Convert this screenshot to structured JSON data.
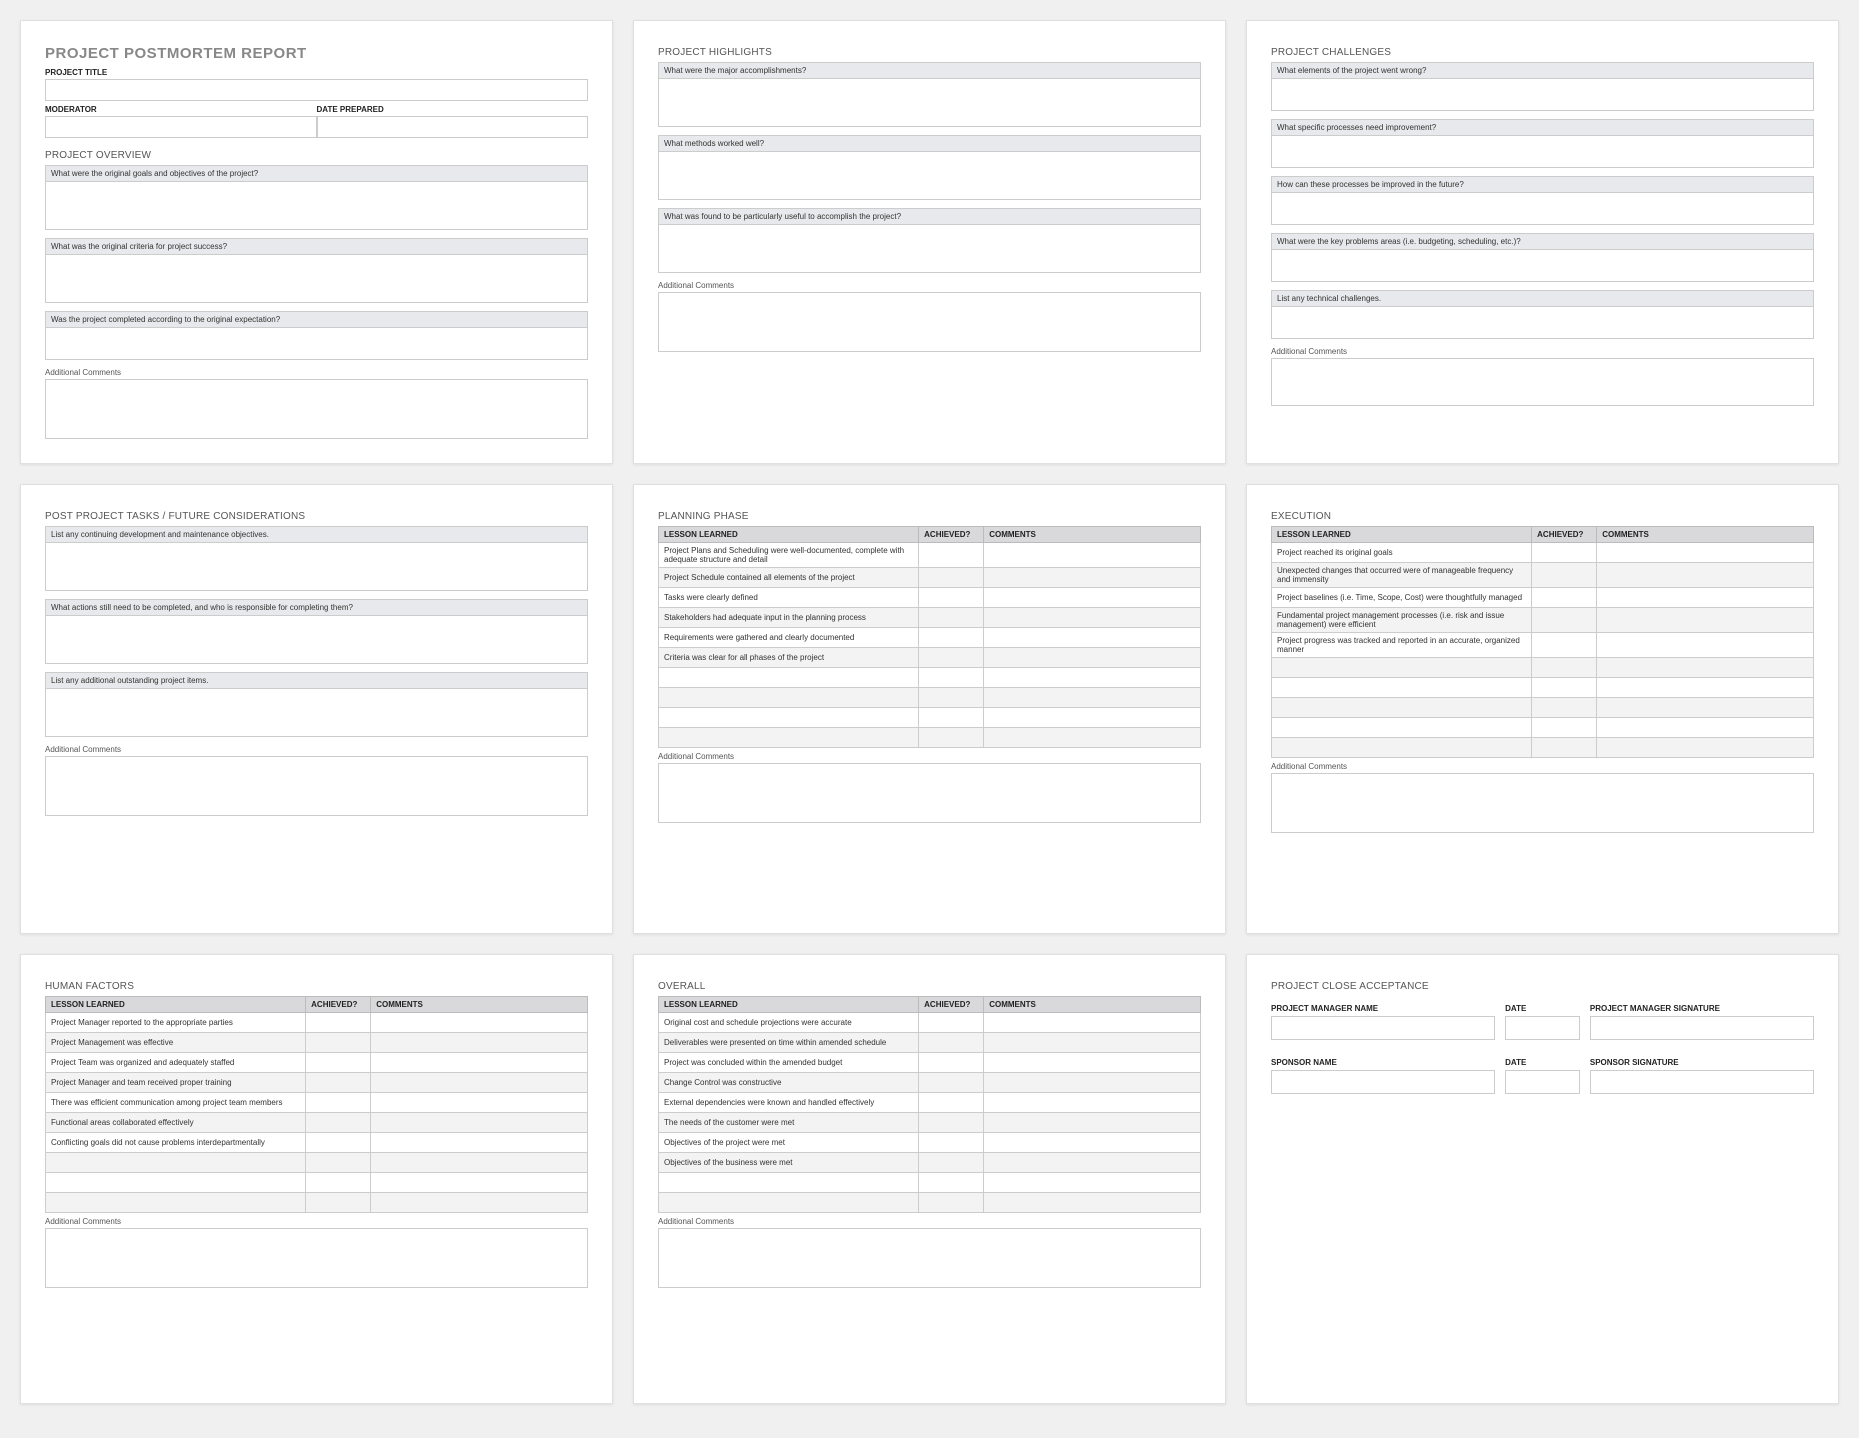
{
  "mainTitle": "PROJECT POSTMORTEM REPORT",
  "labels": {
    "projectTitle": "PROJECT TITLE",
    "moderator": "MODERATOR",
    "datePrepared": "DATE PREPARED",
    "addComments": "Additional Comments",
    "lessonLearned": "LESSON LEARNED",
    "achieved": "ACHIEVED?",
    "comments": "COMMENTS"
  },
  "overview": {
    "title": "PROJECT OVERVIEW",
    "q1": "What were the original goals and objectives of the project?",
    "q2": "What was the original criteria for project success?",
    "q3": "Was the project completed according to the original expectation?"
  },
  "highlights": {
    "title": "PROJECT HIGHLIGHTS",
    "q1": "What were the major accomplishments?",
    "q2": "What methods worked well?",
    "q3": "What was found to be particularly useful to accomplish the project?"
  },
  "challenges": {
    "title": "PROJECT CHALLENGES",
    "q1": "What elements of the project went wrong?",
    "q2": "What specific processes need improvement?",
    "q3": "How can these processes be improved in the future?",
    "q4": "What were the key problems areas (i.e. budgeting, scheduling, etc.)?",
    "q5": "List any technical challenges."
  },
  "postTasks": {
    "title": "POST PROJECT TASKS / FUTURE CONSIDERATIONS",
    "q1": "List any continuing development and maintenance objectives.",
    "q2": "What actions still need to be completed, and who is responsible for completing them?",
    "q3": "List any additional outstanding project items."
  },
  "planning": {
    "title": "PLANNING PHASE",
    "rows": [
      "Project Plans and Scheduling were well-documented, complete with adequate structure and detail",
      "Project Schedule contained all elements of the project",
      "Tasks were clearly defined",
      "Stakeholders had adequate input in the planning process",
      "Requirements were gathered and clearly documented",
      "Criteria was clear for all phases of the project",
      "",
      "",
      "",
      ""
    ]
  },
  "execution": {
    "title": "EXECUTION",
    "rows": [
      "Project reached its original goals",
      "Unexpected changes that occurred were of manageable frequency and immensity",
      "Project baselines (i.e. Time, Scope, Cost) were thoughtfully managed",
      "Fundamental project management processes (i.e. risk and issue management) were efficient",
      "Project progress was tracked and reported in an accurate, organized manner",
      "",
      "",
      "",
      "",
      ""
    ]
  },
  "human": {
    "title": "HUMAN FACTORS",
    "rows": [
      "Project Manager reported to the appropriate parties",
      "Project Management was effective",
      "Project Team was organized and adequately staffed",
      "Project Manager and team received proper training",
      "There was efficient communication among project team members",
      "Functional areas collaborated effectively",
      "Conflicting goals did not cause problems interdepartmentally",
      "",
      "",
      ""
    ]
  },
  "overall": {
    "title": "OVERALL",
    "rows": [
      "Original cost and schedule projections were accurate",
      "Deliverables were presented on time within amended schedule",
      "Project was concluded within the amended budget",
      "Change Control was constructive",
      "External dependencies were known and handled effectively",
      "The needs of the customer were met",
      "Objectives of the project were met",
      "Objectives of the business were met",
      "",
      ""
    ]
  },
  "close": {
    "title": "PROJECT CLOSE ACCEPTANCE",
    "pmName": "PROJECT MANAGER NAME",
    "date": "DATE",
    "pmSig": "PROJECT MANAGER SIGNATURE",
    "spName": "SPONSOR NAME",
    "spSig": "SPONSOR SIGNATURE"
  }
}
